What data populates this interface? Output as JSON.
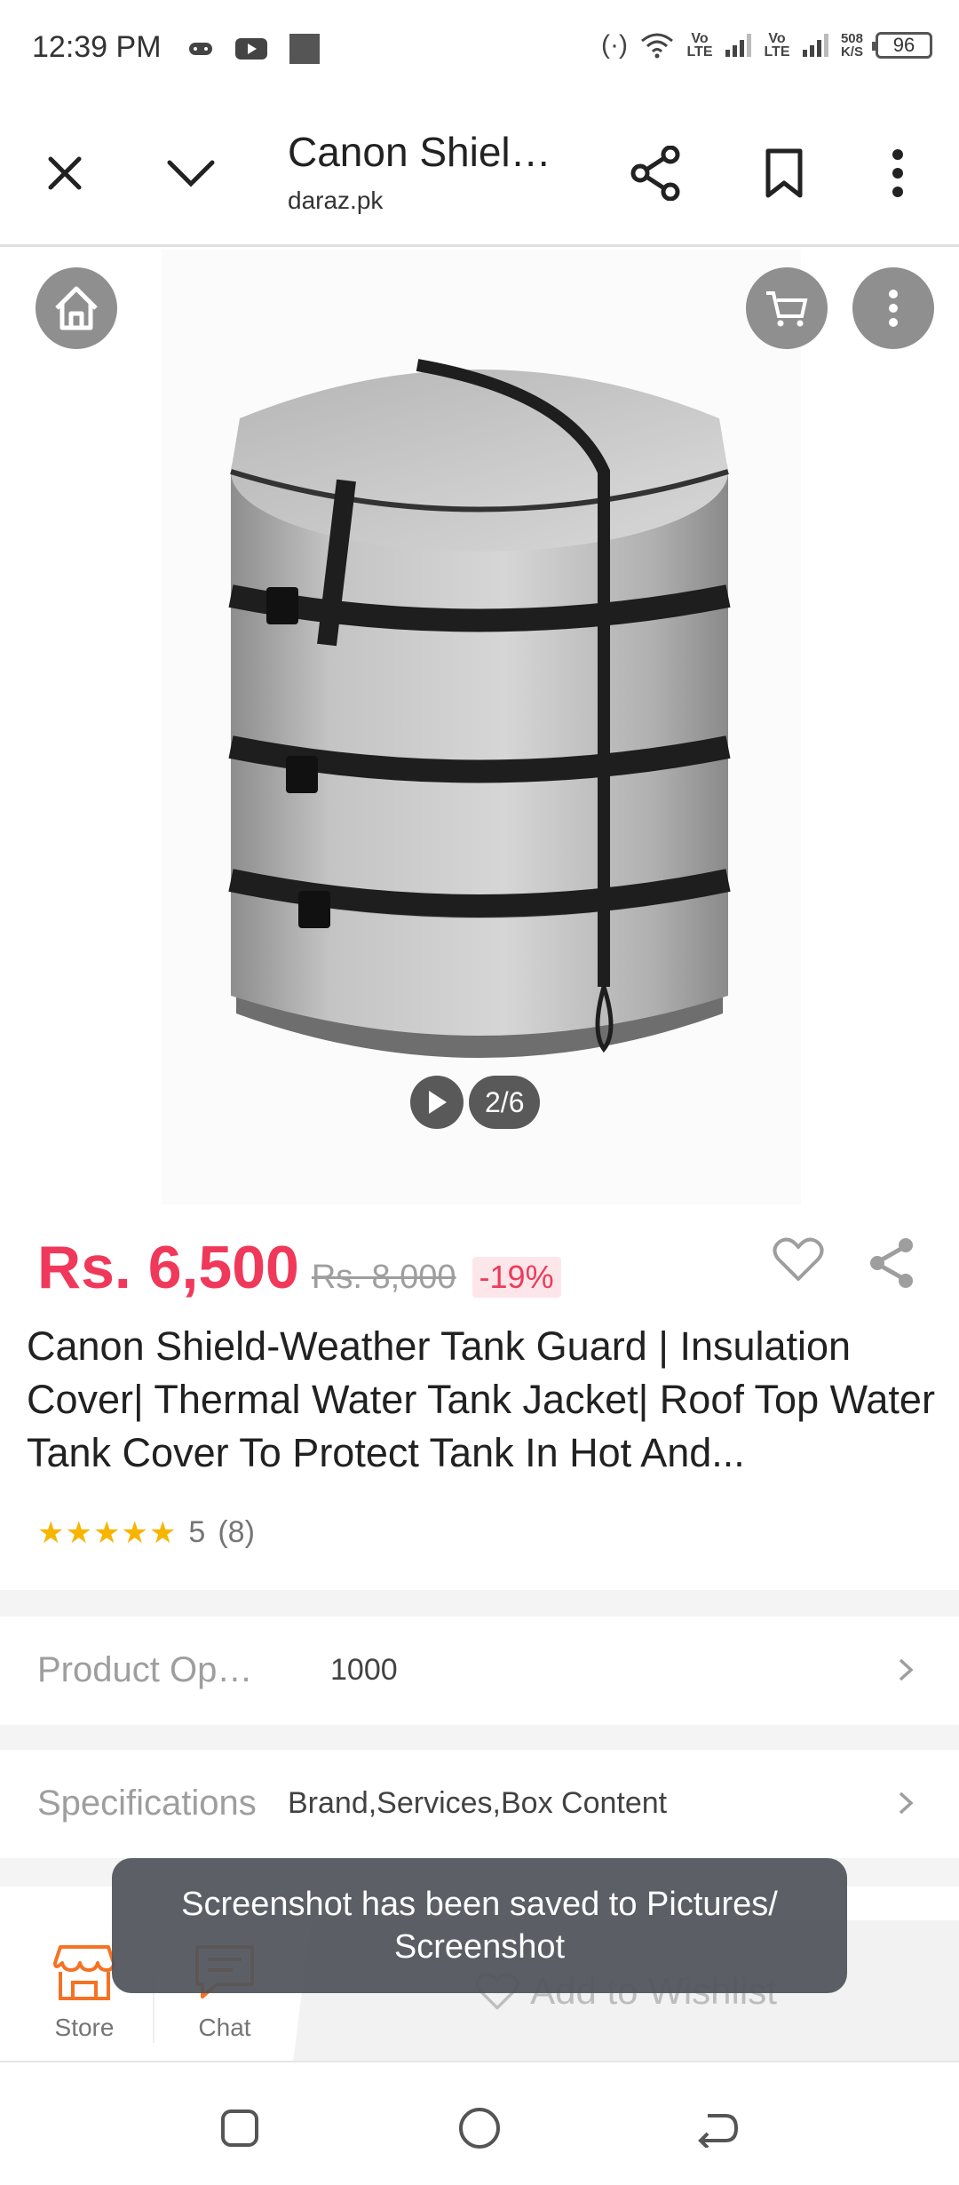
{
  "status_bar": {
    "time": "12:39 PM",
    "volte1": "Vo LTE",
    "volte2": "Vo LTE",
    "speed_value": "508",
    "speed_unit": "K/S",
    "battery": "96"
  },
  "browser": {
    "title": "Canon Shield-Weather Tank Guard | Insulation Cover| Thermal Water Tank Jacket| Roof Top Water Tank Cover To Protect Tank In Hot And...",
    "url": "daraz.pk"
  },
  "media": {
    "counter": "2/6"
  },
  "product": {
    "price": "Rs. 6,500",
    "old_price": "Rs. 8,000",
    "discount": "-19%",
    "title": "Canon Shield-Weather Tank Guard | Insulation Cover| Thermal Water Tank Jacket| Roof Top Water Tank Cover To Protect Tank In Hot And...",
    "rating_value": "5",
    "rating_count": "(8)"
  },
  "rows": {
    "options_label": "Product Options",
    "options_value": "1000",
    "spec_label": "Specifications",
    "spec_value": "Brand,Services,Box Content"
  },
  "action_bar": {
    "store_label": "Store",
    "chat_label": "Chat",
    "wishlist_label": "Add to Wishlist"
  },
  "toast": {
    "message": "Screenshot has been saved to  Pictures/ Screenshot"
  },
  "colors": {
    "price_red": "#f0395a",
    "store_orange": "#f57224",
    "star_gold": "#f7b500"
  }
}
